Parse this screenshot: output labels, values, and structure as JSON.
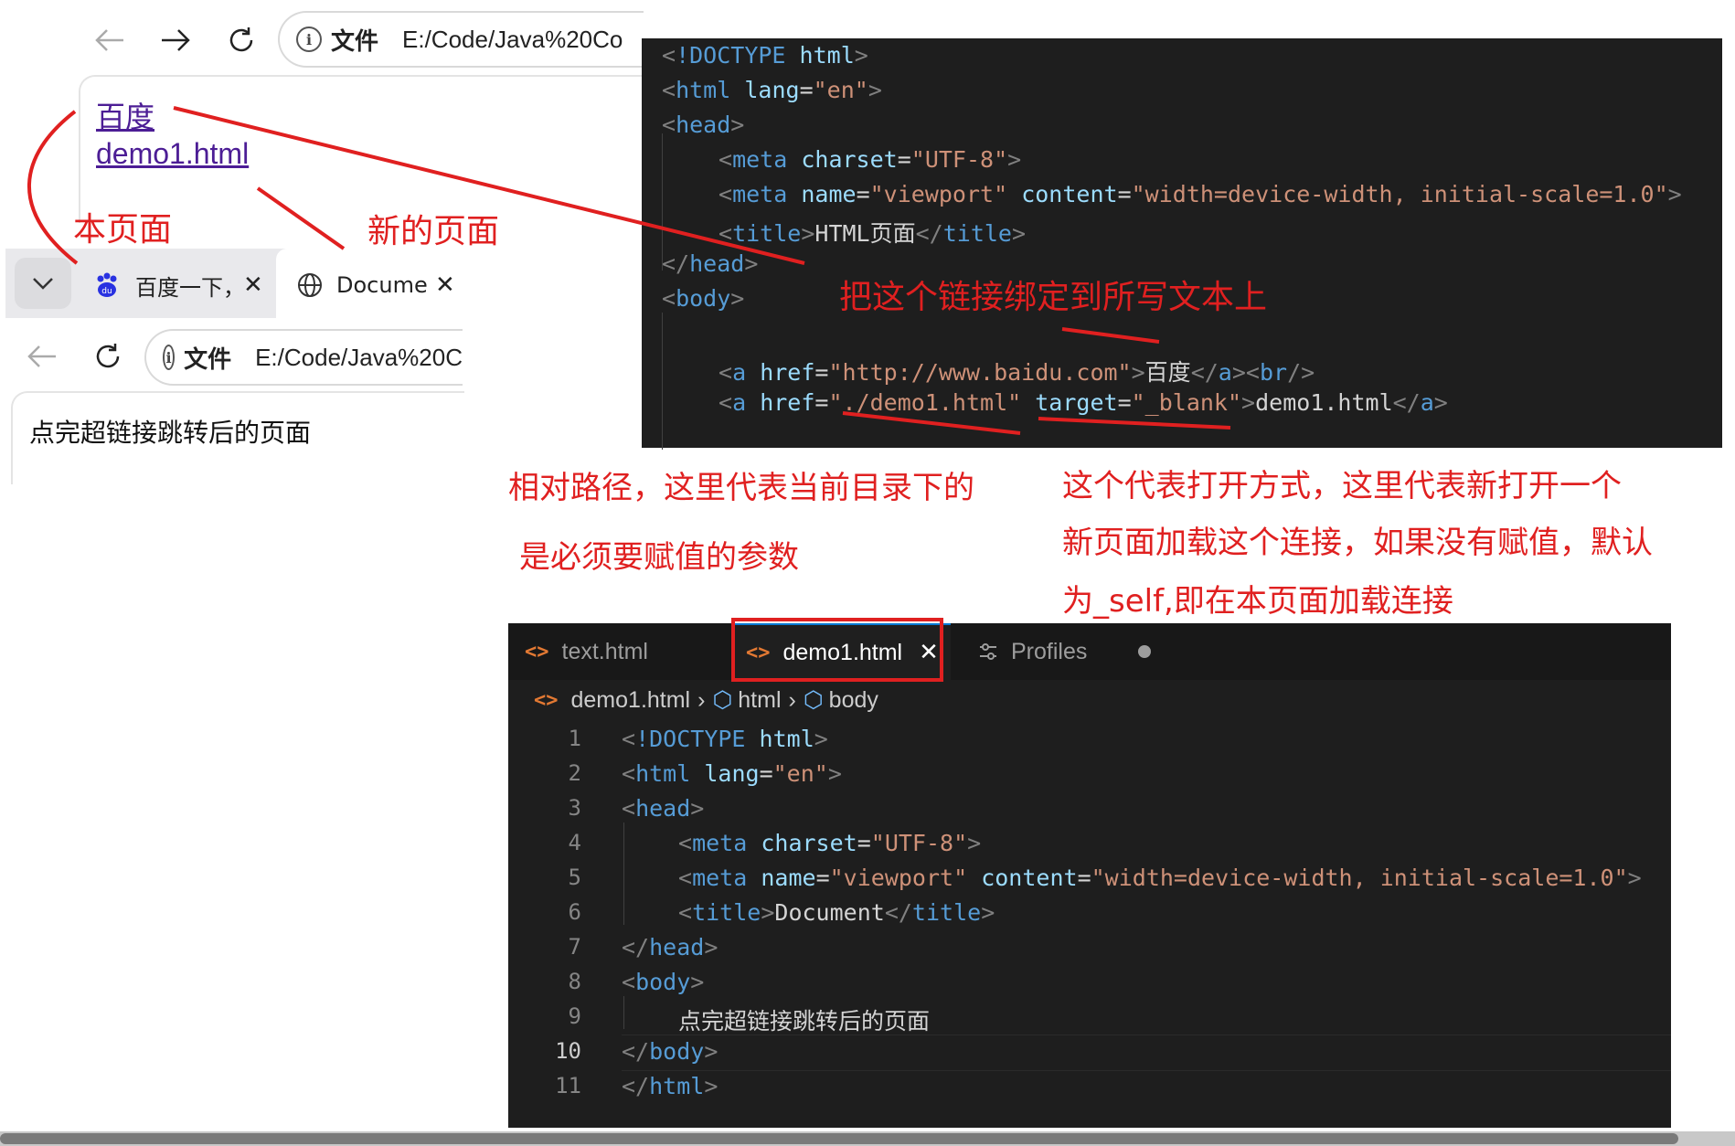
{
  "top_browser": {
    "address_prefix": "文件",
    "address_url": "E:/Code/Java%20Co",
    "links": [
      "百度",
      "demo1.html"
    ]
  },
  "bottom_browser": {
    "tabs": [
      {
        "label": "百度一下，",
        "icon": "baidu-paw-icon"
      },
      {
        "label": "Documen",
        "icon": "globe-icon"
      }
    ],
    "address_prefix": "文件",
    "address_url": "E:/Code/Java%20C",
    "page_text": "点完超链接跳转后的页面"
  },
  "editor_top": {
    "lines": [
      "<!DOCTYPE html>",
      "<html lang=\"en\">",
      "<head>",
      "<meta charset=\"UTF-8\">",
      "<meta name=\"viewport\" content=\"width=device-width, initial-scale=1.0\">",
      "<title>HTML页面</title>",
      "</head>",
      "<body>",
      "",
      "<a href=\"http://www.baidu.com\">百度</a><br/>",
      "<a href=\"./demo1.html\" target=\"_blank\">demo1.html</a>"
    ]
  },
  "editor_bottom": {
    "tabs": [
      {
        "label": "text.html",
        "active": false
      },
      {
        "label": "demo1.html",
        "active": true
      },
      {
        "label": "Profiles",
        "active": false
      }
    ],
    "breadcrumb": [
      "demo1.html",
      "html",
      "body"
    ],
    "line_numbers": [
      "1",
      "2",
      "3",
      "4",
      "5",
      "6",
      "7",
      "8",
      "9",
      "10",
      "11"
    ],
    "lines": [
      "<!DOCTYPE html>",
      "<html lang=\"en\">",
      "<head>",
      "<meta charset=\"UTF-8\">",
      "<meta name=\"viewport\" content=\"width=device-width, initial-scale=1.0\">",
      "<title>Document</title>",
      "</head>",
      "<body>",
      "点完超链接跳转后的页面",
      "</body>",
      "</html>"
    ]
  },
  "annotations": {
    "this_page": "本页面",
    "new_page": "新的页面",
    "bind_link": "把这个链接绑定到所写文本上",
    "relative_path_1": "相对路径，这里代表当前目录下的",
    "relative_path_2": "是必须要赋值的参数",
    "target_1": "这个代表打开方式，这里代表新打开一个",
    "target_2": "新页面加载这个连接，如果没有赋值，默认",
    "target_3": "为_self,即在本页面加载连接"
  },
  "colors": {
    "annotation": "#e02020",
    "editor_bg": "#1e1e1e",
    "link": "#4c1d95"
  }
}
